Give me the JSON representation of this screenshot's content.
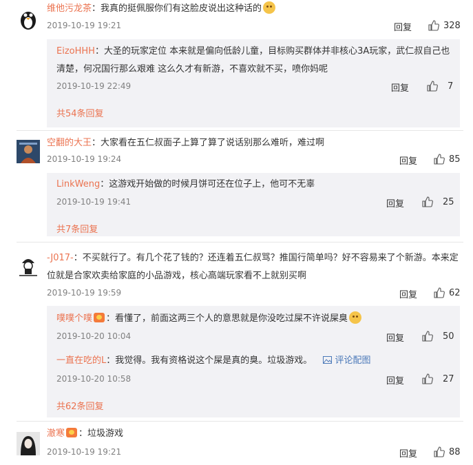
{
  "comments": [
    {
      "user": "维他污龙茶",
      "text": "：我真的挺佩服你们有这脸皮说出这种话的",
      "time": "2019-10-19 19:21",
      "reply_label": "回复",
      "likes": "328",
      "replies": [
        {
          "user": "EizoHHH",
          "text": "：大圣的玩家定位  本来就是偏向低龄儿童，目标购买群体并非核心3A玩家，武仁叔自己也清楚，何况国行那么艰难  这么久才有新游，不喜欢就不买，喷你妈呢",
          "time": "2019-10-19 22:49",
          "reply_label": "回复",
          "likes": "7"
        }
      ],
      "more": "共54条回复"
    },
    {
      "user": "空翻的大王",
      "text": "：大家看在五仁叔面子上算了算了说话别那么难听，难过啊",
      "time": "2019-10-19 19:24",
      "reply_label": "回复",
      "likes": "85",
      "replies": [
        {
          "user": "LinkWeng",
          "text": "：这游戏开始做的时候月饼可还在位子上，他可不无辜",
          "time": "2019-10-19 19:41",
          "reply_label": "回复",
          "likes": "25"
        }
      ],
      "more": "共7条回复"
    },
    {
      "user": "-J017-",
      "text": "：不买就行了。有几个花了钱的？还连着五仁叔骂？推国行简单吗？好不容易来了个新游。本来定位就是合家欢卖给家庭的小品游戏，核心高端玩家看不上就别买啊",
      "time": "2019-10-19 19:59",
      "reply_label": "回复",
      "likes": "62",
      "replies": [
        {
          "user": "噗噗个噗",
          "text": "：看懂了，前面这两三个人的意思就是你没吃过屎不许说屎臭",
          "time": "2019-10-20 10:04",
          "reply_label": "回复",
          "likes": "50"
        },
        {
          "user": "一直在吃的L",
          "text": "：我觉得。我有资格说这个屎是真的臭。垃圾游戏。",
          "link": "评论配图",
          "time": "2019-10-20 10:58",
          "reply_label": "回复",
          "likes": "27"
        }
      ],
      "more": "共62条回复"
    },
    {
      "user": "澈寒",
      "text": "：垃圾游戏",
      "time": "2019-10-19 19:21",
      "reply_label": "回复",
      "likes": "88"
    }
  ]
}
